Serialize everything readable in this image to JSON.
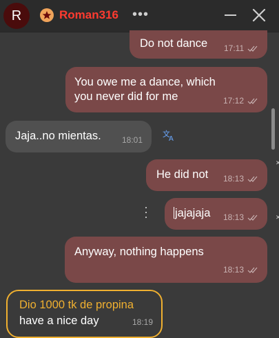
{
  "header": {
    "avatar_letter": "R",
    "username": "Roman316",
    "more_label": "•••"
  },
  "messages": [
    {
      "text": "Do not dance",
      "time": "17:11",
      "direction": "out"
    },
    {
      "text": "You owe me a dance, which\nyou never did for me",
      "time": "17:12",
      "direction": "out"
    },
    {
      "text": "Jaja..no mientas.",
      "time": "18:01",
      "direction": "in"
    },
    {
      "text": "He did not",
      "time": "18:13",
      "direction": "out"
    },
    {
      "text": "jajajaja",
      "time": "18:13",
      "direction": "out"
    },
    {
      "text": "Anyway, nothing happens",
      "time": "18:13",
      "direction": "out"
    }
  ],
  "tip": {
    "title": "Dio 1000 tk de propina",
    "text": "have a nice day",
    "time": "18:19"
  },
  "colors": {
    "outgoing_bubble": "#7a4848",
    "incoming_bubble": "#505050",
    "username": "#ff3b30",
    "tip_accent": "#f0b030"
  },
  "icons": [
    "star-badge-icon",
    "more-icon",
    "minimize-icon",
    "close-icon",
    "double-check-icon",
    "translate-icon",
    "vertical-dots-icon"
  ]
}
